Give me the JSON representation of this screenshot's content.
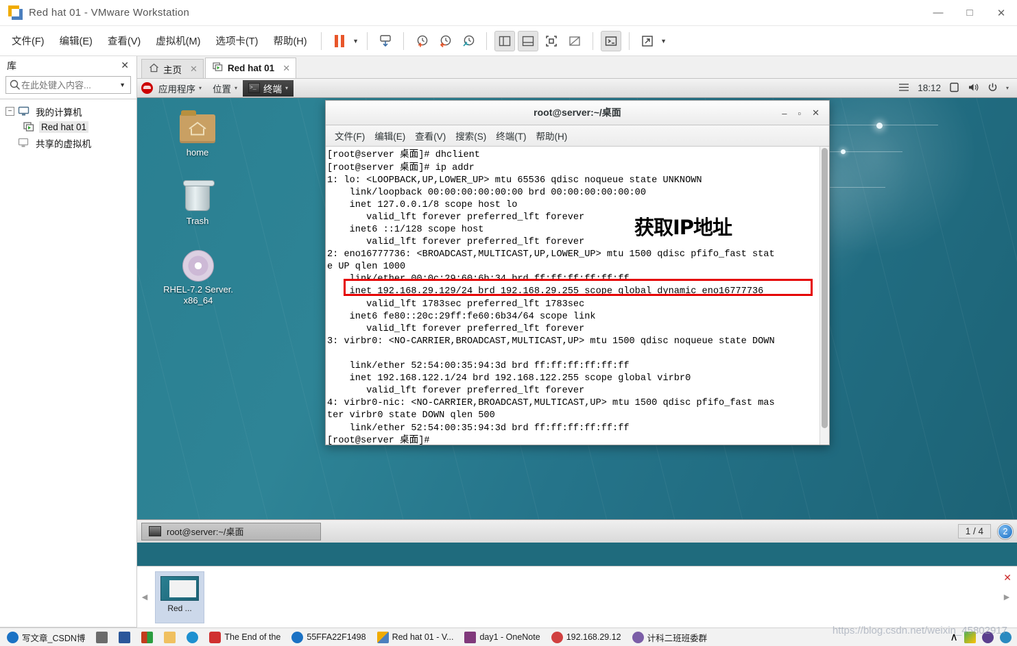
{
  "window": {
    "title": "Red hat 01 - VMware Workstation",
    "logo_icon": "vmware-logo-icon",
    "controls": {
      "minimize": "—",
      "maximize": "□",
      "close": "✕"
    }
  },
  "menubar": {
    "items": [
      {
        "label": "文件(F)",
        "name": "menu-file"
      },
      {
        "label": "编辑(E)",
        "name": "menu-edit"
      },
      {
        "label": "查看(V)",
        "name": "menu-view"
      },
      {
        "label": "虚拟机(M)",
        "name": "menu-vm"
      },
      {
        "label": "选项卡(T)",
        "name": "menu-tabs"
      },
      {
        "label": "帮助(H)",
        "name": "menu-help"
      }
    ]
  },
  "toolbar": {
    "icons": [
      "pause-icon",
      "dropdown-caret-icon",
      "send-snapshot-icon",
      "take-snapshot-icon",
      "revert-snapshot-icon",
      "manage-snapshots-icon",
      "show-library-icon",
      "show-thumbnail-bar-icon",
      "fullscreen-icon",
      "unity-mode-icon",
      "console-view-icon",
      "stretch-fullscreen-icon",
      "dropdown-caret-icon"
    ]
  },
  "sidebar": {
    "title": "库",
    "close_label": "✕",
    "search": {
      "placeholder": "在此处键入内容...",
      "value": "",
      "icon": "search-icon",
      "caret": "▼"
    },
    "tree": [
      {
        "label": "我的计算机",
        "level": 1,
        "expander": "−",
        "icon": "computer-icon",
        "selected": false
      },
      {
        "label": "Red hat 01",
        "level": 2,
        "icon": "vm-running-icon",
        "selected": true
      },
      {
        "label": "共享的虚拟机",
        "level": 1,
        "icon": "shared-vm-icon",
        "selected": false
      }
    ]
  },
  "tabs": [
    {
      "label": "主页",
      "icon": "home-icon",
      "active": false,
      "close": "✕"
    },
    {
      "label": "Red hat 01",
      "icon": "vm-running-icon",
      "active": true,
      "close": "✕"
    }
  ],
  "guest": {
    "top_panel": {
      "logo_icon": "redhat-logo-icon",
      "items": [
        {
          "label": "应用程序",
          "caret": "▾",
          "active": false,
          "name": "applications-menu"
        },
        {
          "label": "位置",
          "caret": "▾",
          "active": false,
          "name": "places-menu"
        },
        {
          "label": "终端",
          "caret": "▾",
          "active": true,
          "name": "terminal-window-menu",
          "icon": "terminal-icon"
        }
      ],
      "right": {
        "menu_icon": "hamburger-menu-icon",
        "clock": "18:12",
        "display_icon": "display-icon",
        "volume_icon": "volume-icon",
        "power_icon": "power-icon",
        "caret": "▾"
      }
    },
    "desktop_icons": [
      {
        "label": "home",
        "icon": "home-folder-icon"
      },
      {
        "label": "Trash",
        "icon": "trash-icon"
      },
      {
        "label": "RHEL-7.2 Server.\nx86_64",
        "icon": "disc-icon"
      }
    ],
    "terminal": {
      "title": "root@server:~/桌面",
      "controls": {
        "minimize": "–",
        "maximize": "▫",
        "close": "✕"
      },
      "menu": [
        "文件(F)",
        "编辑(E)",
        "查看(V)",
        "搜索(S)",
        "终端(T)",
        "帮助(H)"
      ],
      "lines": "[root@server 桌面]# dhclient\n[root@server 桌面]# ip addr\n1: lo: <LOOPBACK,UP,LOWER_UP> mtu 65536 qdisc noqueue state UNKNOWN\n    link/loopback 00:00:00:00:00:00 brd 00:00:00:00:00:00\n    inet 127.0.0.1/8 scope host lo\n       valid_lft forever preferred_lft forever\n    inet6 ::1/128 scope host\n       valid_lft forever preferred_lft forever\n2: eno16777736: <BROADCAST,MULTICAST,UP,LOWER_UP> mtu 1500 qdisc pfifo_fast stat\ne UP qlen 1000\n    link/ether 00:0c:29:60:6b:34 brd ff:ff:ff:ff:ff:ff\n    inet 192.168.29.129/24 brd 192.168.29.255 scope global dynamic eno16777736\n       valid_lft 1783sec preferred_lft 1783sec\n    inet6 fe80::20c:29ff:fe60:6b34/64 scope link\n       valid_lft forever preferred_lft forever\n3: virbr0: <NO-CARRIER,BROADCAST,MULTICAST,UP> mtu 1500 qdisc noqueue state DOWN\n\n    link/ether 52:54:00:35:94:3d brd ff:ff:ff:ff:ff:ff\n    inet 192.168.122.1/24 brd 192.168.122.255 scope global virbr0\n       valid_lft forever preferred_lft forever\n4: virbr0-nic: <NO-CARRIER,BROADCAST,MULTICAST,UP> mtu 1500 qdisc pfifo_fast mas\nter virbr0 state DOWN qlen 500\n    link/ether 52:54:00:35:94:3d brd ff:ff:ff:ff:ff:ff\n[root@server 桌面]# ",
      "highlighted_line": "inet 192.168.29.129/24 brd 192.168.29.255 scope global dynamic eno16777736",
      "highlight_color": "#e50000",
      "annotation": "获取IP地址"
    },
    "taskbar": {
      "window_button": {
        "label": "root@server:~/桌面",
        "icon": "terminal-icon"
      },
      "workspace_indicator": "1 / 4",
      "badge": "2"
    }
  },
  "thumbnail_bar": {
    "left_arrow": "◀",
    "right_arrow": "▶",
    "close": "✕",
    "items": [
      {
        "label": "Red ...",
        "name": "thumbnail-red-hat-01"
      }
    ]
  },
  "host_taskbar": {
    "items": [
      {
        "label": "写文章_CSDN博",
        "icon_color": "#1b72c4",
        "name": "taskbar-csdn"
      },
      {
        "label": "",
        "icon_color": "#6b6b6b",
        "name": "taskbar-calculator"
      },
      {
        "label": "",
        "icon_color": "#2b579a",
        "name": "taskbar-word"
      },
      {
        "label": "",
        "icon_color": "#c43b1d",
        "name": "taskbar-app"
      },
      {
        "label": "",
        "icon_color": "#f0c060",
        "name": "taskbar-explorer"
      },
      {
        "label": "",
        "icon_color": "#1e90d0",
        "name": "taskbar-edge"
      },
      {
        "label": "The End of the",
        "icon_color": "#d03030",
        "name": "taskbar-media"
      },
      {
        "label": "55FFA22F1498",
        "icon_color": "#1b72c4",
        "name": "taskbar-window-1"
      },
      {
        "label": "Red hat 01 - V...",
        "icon_color": "#e8562a",
        "name": "taskbar-vmware"
      },
      {
        "label": "day1 - OneNote",
        "icon_color": "#80397b",
        "name": "taskbar-onenote"
      },
      {
        "label": "192.168.29.12",
        "icon_color": "#d04040",
        "name": "taskbar-xshell"
      },
      {
        "label": "计科二班班委群",
        "icon_color": "#7b5ea7",
        "name": "taskbar-qq"
      }
    ],
    "tray": {
      "caret": "∧",
      "icons": [
        "tray-icon-1",
        "tray-icon-2",
        "tray-icon-3"
      ]
    }
  },
  "watermark": "https://blog.csdn.net/weixin_45802917"
}
